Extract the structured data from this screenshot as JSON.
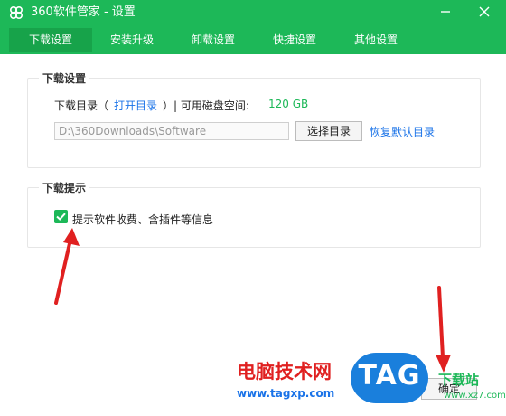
{
  "window": {
    "title": "360软件管家 - 设置"
  },
  "tabs": [
    {
      "label": "下载设置",
      "active": true
    },
    {
      "label": "安装升级",
      "active": false
    },
    {
      "label": "卸载设置",
      "active": false
    },
    {
      "label": "快捷设置",
      "active": false
    },
    {
      "label": "其他设置",
      "active": false
    }
  ],
  "download_settings": {
    "legend": "下载设置",
    "dir_label": "下载目录（",
    "open_dir_link": "打开目录",
    "available_label": "）| 可用磁盘空间:",
    "available_value": "120 GB",
    "path_value": "D:\\360Downloads\\Software",
    "choose_dir_button": "选择目录",
    "restore_default_link": "恢复默认目录"
  },
  "download_tips": {
    "legend": "下载提示",
    "checkbox_label": "提示软件收费、含插件等信息",
    "checkbox_checked": true
  },
  "footer": {
    "confirm_button": "确定"
  },
  "watermark": {
    "site_name": "电脑技术网",
    "site_url": "www.tagxp.com",
    "logo_text": "TAG",
    "side_text": "下载站",
    "side_url": "www.xz7.com"
  },
  "colors": {
    "accent": "#1db858",
    "accent_dark": "#17a34a",
    "link": "#1a73e8",
    "arrow": "#e02020"
  }
}
